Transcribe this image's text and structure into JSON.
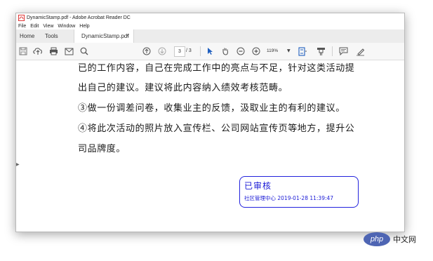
{
  "window": {
    "title": "DynamicStamp.pdf - Adobe Acrobat Reader DC"
  },
  "menu": {
    "items": [
      "File",
      "Edit",
      "View",
      "Window",
      "Help"
    ]
  },
  "tabs": {
    "home": "Home",
    "tools": "Tools",
    "document": "DynamicStamp.pdf",
    "close": "×"
  },
  "toolbar": {
    "current_page": "3",
    "page_total": "/ 3",
    "zoom": "119%",
    "icons": [
      "save-icon",
      "upload-icon",
      "print-icon",
      "email-icon",
      "search-icon",
      "page-up-icon",
      "page-down-icon",
      "select-arrow-icon",
      "hand-icon",
      "zoom-out-icon",
      "zoom-in-icon",
      "fit-page-icon",
      "highlighter-icon",
      "comment-icon",
      "sign-pen-icon"
    ]
  },
  "document": {
    "lines": [
      "已的工作内容，自己在完成工作中的亮点与不足，针对这类活动提",
      "出自己的建议。建议将此内容纳入绩效考核范畴。",
      "③做一份调差问卷，收集业主的反馈，汲取业主的有利的建议。",
      "④将此次活动的照片放入宣传栏、公司网站宣传页等地方，提升公",
      "司品牌度。"
    ]
  },
  "stamp": {
    "title": "已审核",
    "subtitle": "社区管理中心 2019-01-28 11:39:47",
    "color": "#1a1ad6"
  },
  "watermark": {
    "logo_text": "php",
    "text": "中文网",
    "color": "#4e65b3"
  }
}
